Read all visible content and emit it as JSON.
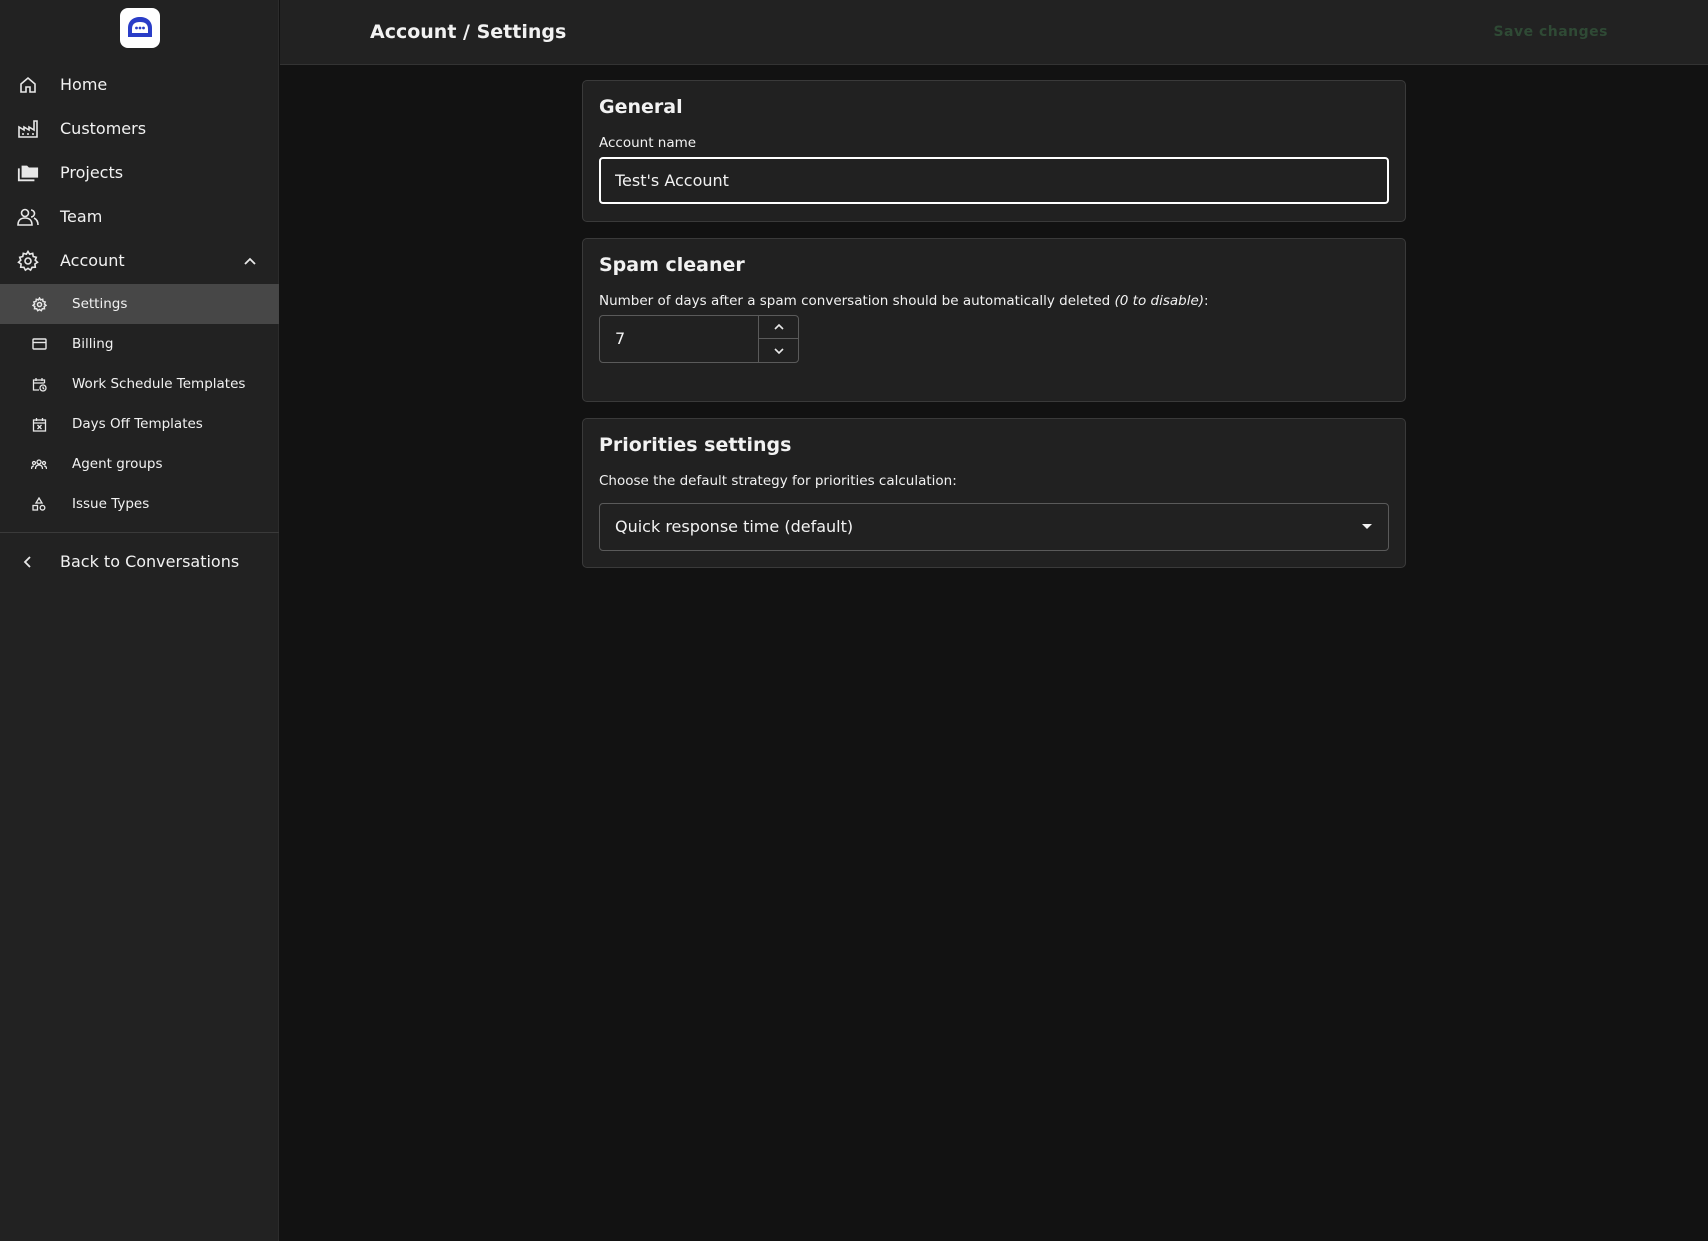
{
  "sidebar": {
    "logo_icon": "chat-bubble-logo-icon",
    "nav": [
      {
        "label": "Home",
        "icon": "home-icon"
      },
      {
        "label": "Customers",
        "icon": "factory-icon"
      },
      {
        "label": "Projects",
        "icon": "folders-icon"
      },
      {
        "label": "Team",
        "icon": "people-icon"
      },
      {
        "label": "Account",
        "icon": "gear-icon",
        "expanded": true
      }
    ],
    "sub_items": [
      {
        "label": "Settings",
        "icon": "gear-small-icon",
        "active": true
      },
      {
        "label": "Billing",
        "icon": "credit-card-icon"
      },
      {
        "label": "Work Schedule Templates",
        "icon": "calendar-clock-icon"
      },
      {
        "label": "Days Off Templates",
        "icon": "calendar-x-icon"
      },
      {
        "label": "Agent groups",
        "icon": "group-icon"
      },
      {
        "label": "Issue Types",
        "icon": "shapes-icon"
      }
    ],
    "back_label": "Back to Conversations"
  },
  "header": {
    "breadcrumb": "Account / Settings",
    "save_label": "Save changes"
  },
  "general": {
    "title": "General",
    "account_name_label": "Account name",
    "account_name_value": "Test's Account"
  },
  "spam": {
    "title": "Spam cleaner",
    "description": "Number of days after a spam conversation should be automatically deleted ",
    "description_hint": "(0 to disable)",
    "description_suffix": ":",
    "days_value": "7"
  },
  "priorities": {
    "title": "Priorities settings",
    "description": "Choose the default strategy for priorities calculation:",
    "selected": "Quick response time (default)"
  },
  "colors": {
    "sidebar_bg": "#222222",
    "main_bg": "#121212",
    "active_item_bg": "#474747",
    "logo_blue": "#2a3dc7",
    "save_disabled": "#2f4a35"
  }
}
